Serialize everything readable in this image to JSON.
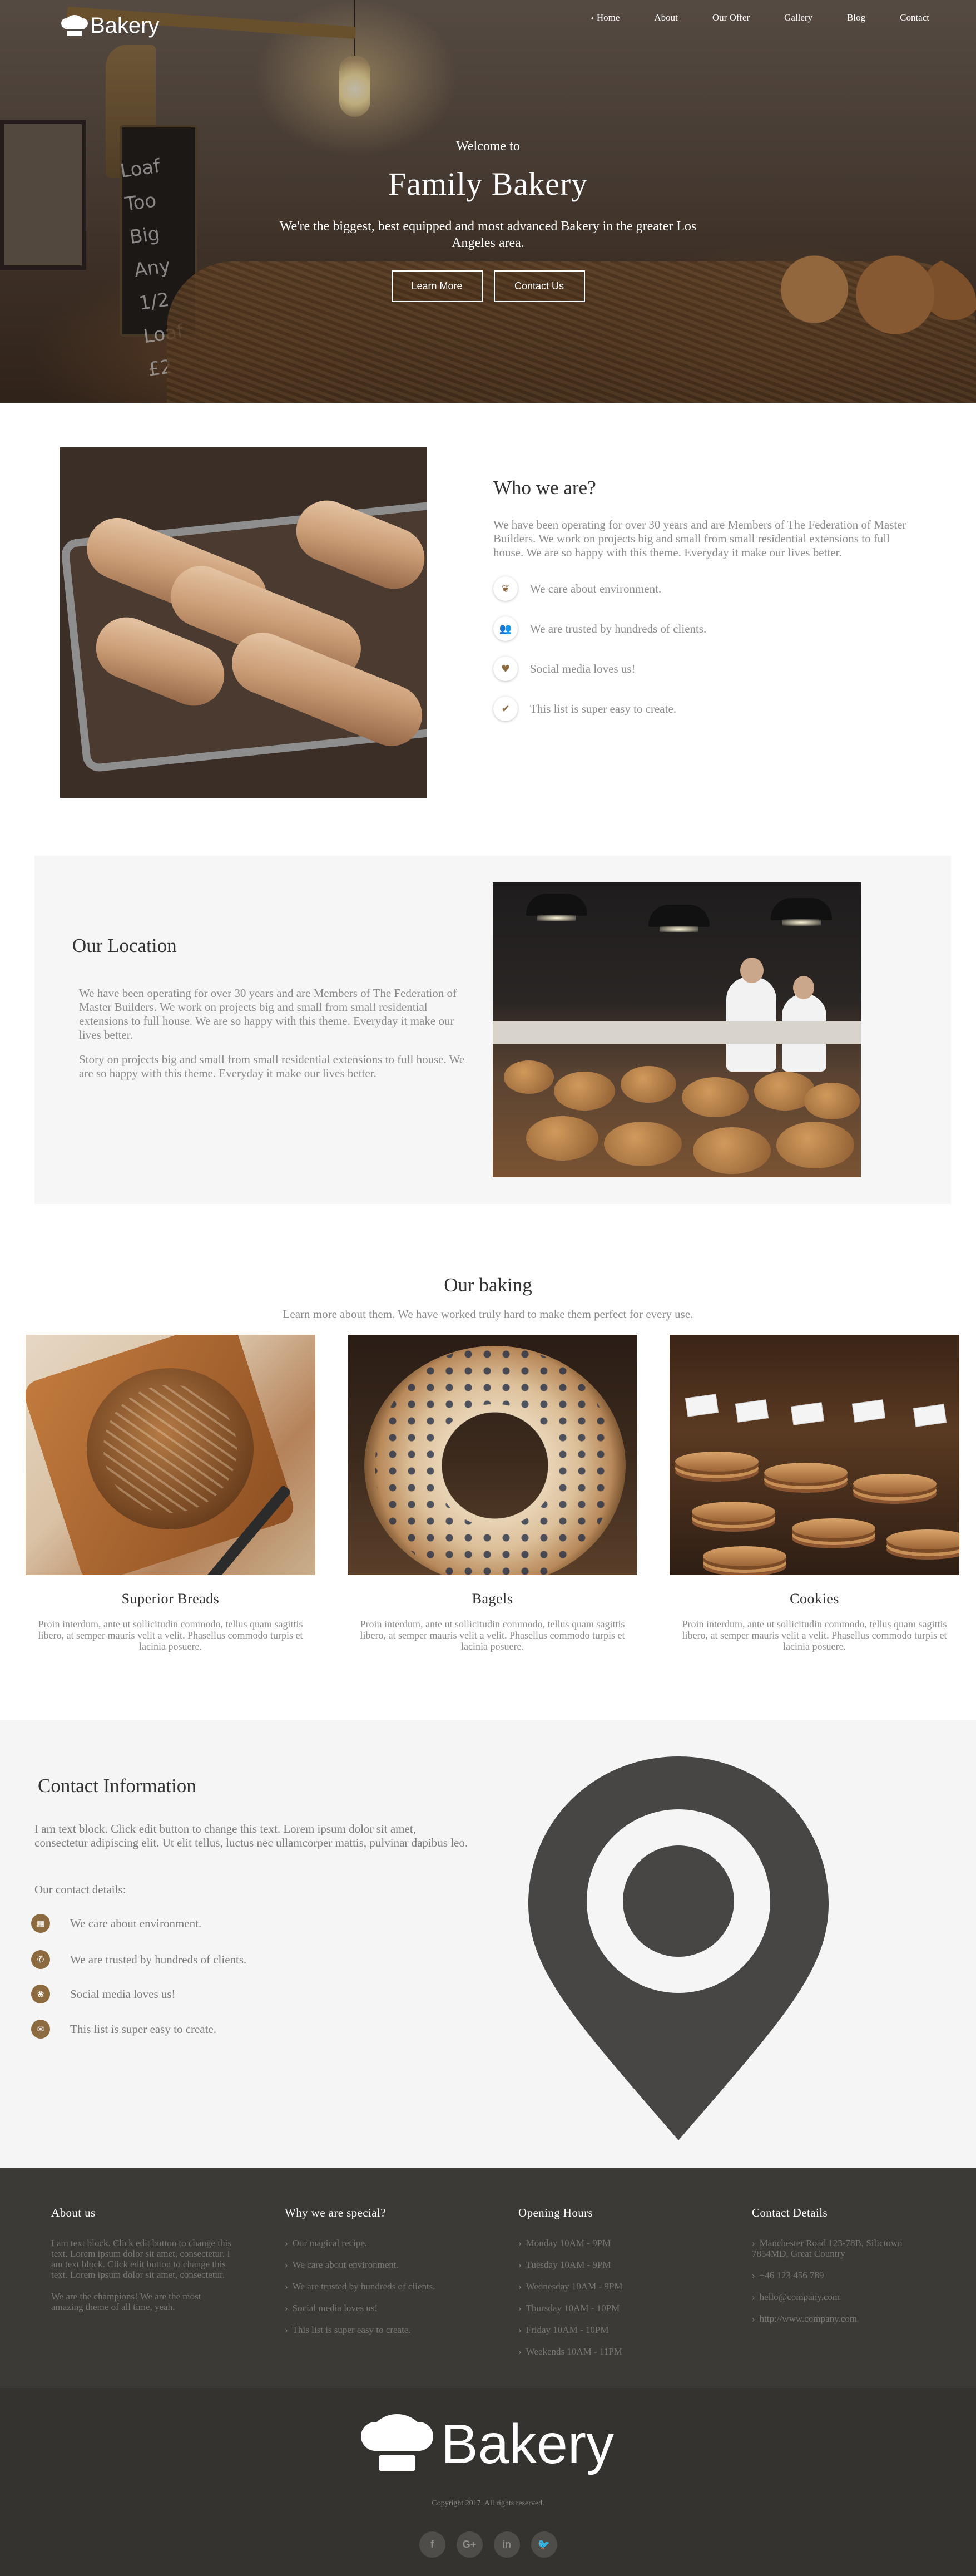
{
  "brand": {
    "name": "Bakery"
  },
  "nav": {
    "items": [
      "Home",
      "About",
      "Our Offer",
      "Gallery",
      "Blog",
      "Contact"
    ],
    "active": "Home"
  },
  "hero": {
    "welcome": "Welcome to",
    "title": "Family Bakery",
    "subtitle": "We're the biggest, best equipped and most advanced Bakery in the greater Los Angeles area.",
    "buttons": [
      "Learn More",
      "Contact Us"
    ],
    "chalkboard": "Loaf Too Big Any 1/2 Loaf £2"
  },
  "who": {
    "title": "Who we are?",
    "text": "We have been operating for over 30 years and are Members of The Federation of Master Builders. We work on projects big and small from small residential extensions to full house. We are so happy with this theme. Everyday it make our lives better.",
    "features": [
      {
        "icon": "leaf-icon",
        "glyph": "❦",
        "label": "We care about environment."
      },
      {
        "icon": "users-icon",
        "glyph": "👥",
        "label": "We are trusted by hundreds of clients."
      },
      {
        "icon": "heart-icon",
        "glyph": "♥",
        "label": "Social media loves us!"
      },
      {
        "icon": "check-icon",
        "glyph": "✔",
        "label": "This list is super easy to create."
      }
    ]
  },
  "location": {
    "title": "Our Location",
    "p1": "We have been operating for over 30 years and are Members of The Federation of Master Builders. We work on projects big and small from small residential extensions to full house. We are so happy with this theme. Everyday it make our lives better.",
    "p2": "Story on projects big and small from small residential extensions to full house. We are so happy with this theme. Everyday it make our lives better."
  },
  "baking": {
    "title": "Our baking",
    "lead": "Learn more about them. We have worked truly hard to make them perfect for every use.",
    "items": [
      {
        "name": "Superior Breads",
        "desc": "Proin interdum, ante ut sollicitudin commodo, tellus quam sagittis libero, at semper mauris velit a velit. Phasellus commodo turpis et lacinia posuere."
      },
      {
        "name": "Bagels",
        "desc": "Proin interdum, ante ut sollicitudin commodo, tellus quam sagittis libero, at semper mauris velit a velit. Phasellus commodo turpis et lacinia posuere."
      },
      {
        "name": "Cookies",
        "desc": "Proin interdum, ante ut sollicitudin commodo, tellus quam sagittis libero, at semper mauris velit a velit. Phasellus commodo turpis et lacinia posuere."
      }
    ]
  },
  "contact": {
    "title": "Contact Information",
    "intro": "I am text block. Click edit button to change this text. Lorem ipsum dolor sit amet, consectetur adipiscing elit. Ut elit tellus, luctus nec ullamcorper mattis, pulvinar dapibus leo.",
    "details_title": "Our contact details:",
    "items": [
      {
        "icon": "map-icon",
        "glyph": "▦",
        "label": "We care about environment."
      },
      {
        "icon": "phone-icon",
        "glyph": "✆",
        "label": "We are trusted by hundreds of clients."
      },
      {
        "icon": "globe-icon",
        "glyph": "❀",
        "label": "Social media loves us!"
      },
      {
        "icon": "mail-icon",
        "glyph": "✉",
        "label": "This list is super easy to create."
      }
    ],
    "pin_icon": "map-pin-icon"
  },
  "footer": {
    "about": {
      "title": "About us",
      "p1": "I am text block. Click edit button to change this text. Lorem ipsum dolor sit amet, consectetur. I am text block. Click edit button to change this text. Lorem ipsum dolor sit amet, consectetur.",
      "p2": "We are the champions! We are the most amazing theme of all time, yeah."
    },
    "special": {
      "title": "Why we are special?",
      "items": [
        "Our magical recipe.",
        "We care about environment.",
        "We are trusted by hundreds of clients.",
        "Social media loves us!",
        "This list is super easy to create."
      ]
    },
    "hours": {
      "title": "Opening Hours",
      "items": [
        "Monday 10AM - 9PM",
        "Tuesday 10AM - 9PM",
        "Wednesday 10AM - 9PM",
        "Thursday 10AM - 10PM",
        "Friday 10AM - 10PM",
        "Weekends 10AM - 11PM"
      ]
    },
    "contact": {
      "title": "Contact Details",
      "items": [
        "Manchester Road 123-78B, Silictown 7854MD, Great Country",
        "+46 123 456 789",
        "hello@company.com",
        "http://www.company.com"
      ]
    },
    "copyright": "Copyright 2017. All rights reserved.",
    "socials": [
      {
        "icon": "facebook-icon",
        "glyph": "f"
      },
      {
        "icon": "google-plus-icon",
        "glyph": "G+"
      },
      {
        "icon": "linkedin-icon",
        "glyph": "in"
      },
      {
        "icon": "twitter-icon",
        "glyph": "🐦"
      }
    ]
  },
  "colors": {
    "accent": "#8b6b3f",
    "footer_top": "#3c3a36",
    "footer_bottom": "#353330",
    "text_muted": "#8c8c8c"
  }
}
